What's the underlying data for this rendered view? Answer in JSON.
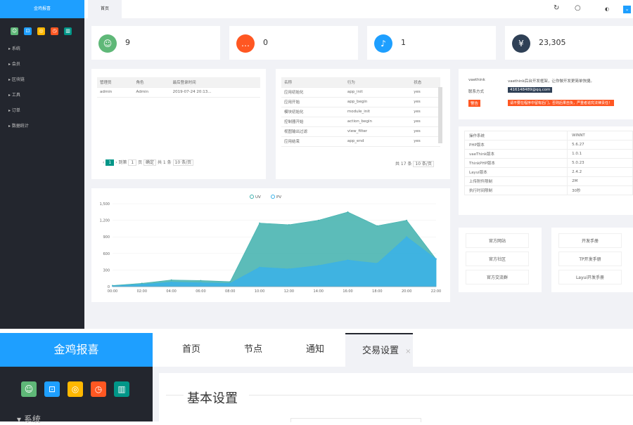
{
  "top": {
    "logo": "金鸡报喜",
    "sidebar_items": [
      "系统",
      "会员",
      "区块链",
      "工具",
      "订单",
      "数据统计"
    ],
    "header_tab": "首页",
    "stats": [
      {
        "value": "9",
        "color": "#5FB878",
        "icon": "user-icon",
        "glyph": "☺"
      },
      {
        "value": "0",
        "color": "#FF5722",
        "icon": "chat-icon",
        "glyph": "…"
      },
      {
        "value": "1",
        "color": "#1E9FFF",
        "icon": "bell-icon",
        "glyph": "♪"
      },
      {
        "value": "23,305",
        "color": "#2F4056",
        "icon": "yen-icon",
        "glyph": "¥"
      }
    ],
    "admin_table": {
      "headers": [
        "管理员",
        "角色",
        "最后登录时间"
      ],
      "rows": [
        [
          "admin",
          "Admin",
          "2019-07-24 20:13..."
        ]
      ],
      "pager": {
        "page": "1",
        "goto_label": "到第",
        "input": "1",
        "page_unit": "页",
        "confirm": "确定",
        "total": "共 1 条",
        "per_page": "10 条/页"
      }
    },
    "hook_table": {
      "headers": [
        "名称",
        "行为",
        "状态"
      ],
      "rows": [
        [
          "应用初始化",
          "app_init",
          "yes"
        ],
        [
          "应用开始",
          "app_begin",
          "yes"
        ],
        [
          "模块初始化",
          "module_init",
          "yes"
        ],
        [
          "控制器开始",
          "action_begin",
          "yes"
        ],
        [
          "视图输出过滤",
          "view_filter",
          "yes"
        ],
        [
          "应用结束",
          "app_end",
          "yes"
        ]
      ],
      "pager": {
        "total": "共 17 条",
        "per_page": "10 条/页"
      }
    },
    "chart_legend": [
      "UV",
      "PV"
    ],
    "info_box": {
      "desc_label": "vaethink",
      "desc_text": "vaethink后台开发框架，让你做开发更简单快捷。",
      "qq_label": "联系方式",
      "qq_value": "416148489@qq.com",
      "warn_label": "警告",
      "warn_text": "请不要在程序中留有后门，否则后果自负，严重者追究法律责任！"
    },
    "sys_info": [
      [
        "操作系统",
        "WINNT"
      ],
      [
        "PHP版本",
        "5.6.27"
      ],
      [
        "vaeThink版本",
        "1.0.1"
      ],
      [
        "ThinkPHP版本",
        "5.0.23"
      ],
      [
        "Layui版本",
        "2.4.2"
      ],
      [
        "上传附件限制",
        "2M"
      ],
      [
        "执行时间限制",
        "30秒"
      ]
    ],
    "links_left": [
      "官方网站",
      "官方社区",
      "官方交流群"
    ],
    "links_right": [
      "开发手册",
      "TP开发手册",
      "Layui开发手册"
    ]
  },
  "chart_data": {
    "type": "area",
    "x": [
      "00:00",
      "02:00",
      "04:00",
      "06:00",
      "08:00",
      "10:00",
      "12:00",
      "14:00",
      "16:00",
      "18:00",
      "20:00",
      "22:00"
    ],
    "series": [
      {
        "name": "UV",
        "color": "#3fb0ad",
        "values": [
          20,
          60,
          120,
          110,
          90,
          1150,
          1120,
          1200,
          1350,
          1100,
          1200,
          500
        ]
      },
      {
        "name": "PV",
        "color": "#3ab1e8",
        "values": [
          10,
          40,
          80,
          70,
          60,
          350,
          320,
          380,
          480,
          420,
          900,
          500
        ]
      }
    ],
    "ylim": [
      0,
      1500
    ],
    "yticks": [
      "0",
      "300",
      "600",
      "900",
      "1,200",
      "1,500"
    ],
    "legend": "top"
  },
  "bottom": {
    "logo": "金鸡报喜",
    "tabs": [
      "首页",
      "节点",
      "通知",
      "交易设置"
    ],
    "close": "×",
    "section_title": "基本设置",
    "sidebar_first": "系统",
    "quick_icons": [
      {
        "icon": "user-icon",
        "glyph": "☺",
        "color": "#5FB878"
      },
      {
        "icon": "lock-icon",
        "glyph": "⊡",
        "color": "#1E9FFF"
      },
      {
        "icon": "globe-icon",
        "glyph": "◎",
        "color": "#FFB800"
      },
      {
        "icon": "clock-icon",
        "glyph": "◷",
        "color": "#FF5722"
      },
      {
        "icon": "trash-icon",
        "glyph": "▥",
        "color": "#009688"
      }
    ]
  }
}
